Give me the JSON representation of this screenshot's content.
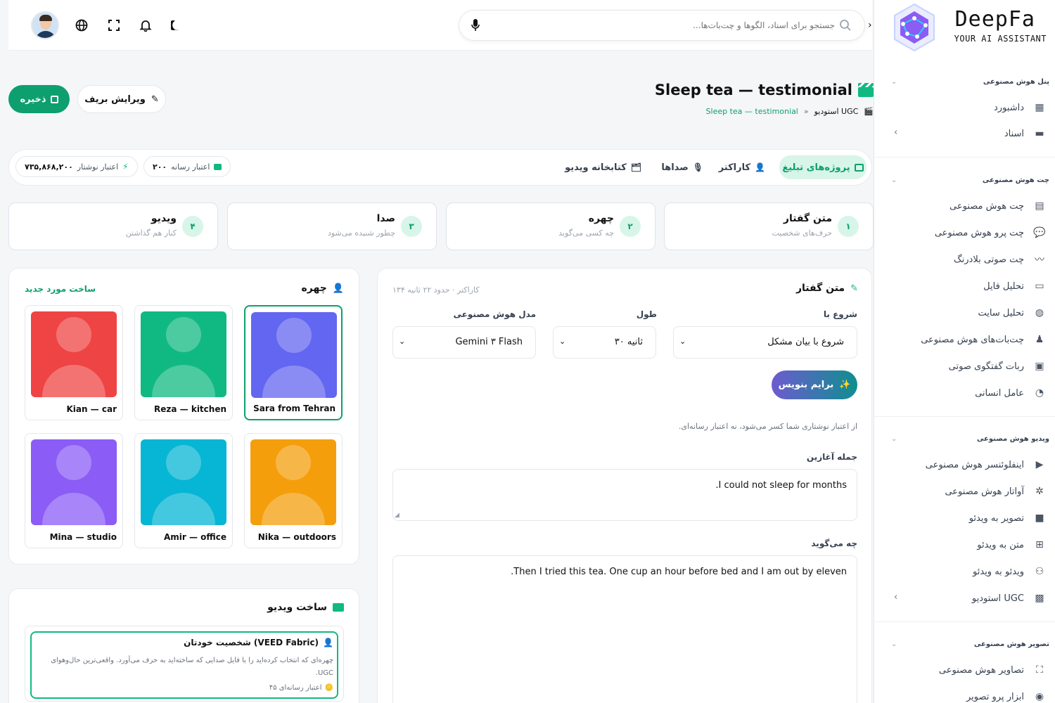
{
  "brand": {
    "name": "DeepFa",
    "tagline": "YOUR AI ASSISTANT"
  },
  "search": {
    "placeholder": "جستجو برای اسناد، الگوها و چت‌بات‌ها..."
  },
  "page": {
    "title": "Sleep tea — testimonial",
    "breadcrumb_root": "استودیو UGC",
    "breadcrumb_sep": "»",
    "breadcrumb_current": "Sleep tea — testimonial"
  },
  "actions": {
    "save": "ذخیره",
    "edit_brief": "ویرایش بریف"
  },
  "tabs": [
    {
      "label": "پروژه‌های تبلیغ"
    },
    {
      "label": "کاراکتر"
    },
    {
      "label": "صداها"
    },
    {
      "label": "کتابخانه ویدیو"
    }
  ],
  "credits": {
    "media_label": "اعتبار رسانه",
    "media_value": "۲۰۰",
    "writing_label": "اعتبار نوشتار",
    "writing_value": "۷۳۵,۸۶۸,۲۰۰"
  },
  "steps": [
    {
      "num": "۱",
      "title": "متن گفتار",
      "sub": "حرف‌های شخصیت"
    },
    {
      "num": "۲",
      "title": "چهره",
      "sub": "چه کسی می‌گوید"
    },
    {
      "num": "۳",
      "title": "صدا",
      "sub": "چطور شنیده می‌شود"
    },
    {
      "num": "۴",
      "title": "ویدیو",
      "sub": "کنار هم گذاشتن"
    }
  ],
  "script": {
    "title": "متن گفتار",
    "meta": "۱۳۴ کاراکتر · حدود ۲۲ ثانیه",
    "start_label": "شروع با",
    "start_value": "شروع با بیان مشکل",
    "length_label": "طول",
    "length_value": "۳۰ ثانیه",
    "model_label": "مدل هوش مصنوعی",
    "model_value": "Gemini ۳ Flash",
    "write_btn": "برایم بنویس",
    "note": "از اعتبار نوشتاری شما کسر می‌شود، نه اعتبار رسانه‌ای.",
    "hook_label": "جمله آغازین",
    "hook_value": "I could not sleep for months.",
    "says_label": "چه می‌گوید",
    "says_value": "Then I tried this tea. One cup an hour before bed and I am out by eleven."
  },
  "faces": {
    "title": "چهره",
    "new_link": "ساخت مورد جدید",
    "items": [
      {
        "name": "Sara from Tehran",
        "color": "#6366f1"
      },
      {
        "name": "Reza — kitchen",
        "color": "#10b981"
      },
      {
        "name": "Kian — car",
        "color": "#ef4444"
      },
      {
        "name": "Nika — outdoors",
        "color": "#f59e0b"
      },
      {
        "name": "Amir — office",
        "color": "#06b6d4"
      },
      {
        "name": "Mina — studio",
        "color": "#8b5cf6"
      }
    ]
  },
  "video": {
    "title": "ساخت ویدیو",
    "option_title": "شخصیت خودتان (VEED Fabric)",
    "option_desc": "چهره‌ای که انتخاب کرده‌اید را با فایل صدایی که ساخته‌اید به حرف می‌آورد. واقعی‌ترین حال‌وهوای UGC.",
    "option_cost": "۴۵ اعتبار رسانه‌ای"
  },
  "sidebar": {
    "sections": [
      {
        "title": "پنل هوش مصنوعی",
        "items": [
          {
            "label": "داشبورد",
            "icon": "dashboard-icon"
          },
          {
            "label": "اسناد",
            "icon": "folder-icon"
          }
        ]
      },
      {
        "title": "چت هوش مصنوعی",
        "items": [
          {
            "label": "چت هوش مصنوعی",
            "icon": "chat-icon"
          },
          {
            "label": "چت پرو هوش مصنوعی",
            "icon": "chat-pro-icon"
          },
          {
            "label": "چت صوتی بلادرنگ",
            "icon": "waveform-icon"
          },
          {
            "label": "تحلیل فایل",
            "icon": "file-icon"
          },
          {
            "label": "تحلیل سایت",
            "icon": "globe-icon"
          },
          {
            "label": "چت‌بات‌های هوش مصنوعی",
            "icon": "robot-icon"
          },
          {
            "label": "ربات گفتگوی صوتی",
            "icon": "voice-bot-icon"
          },
          {
            "label": "عامل انسانی",
            "icon": "headset-icon"
          }
        ]
      },
      {
        "title": "ویدیو هوش مصنوعی",
        "items": [
          {
            "label": "اینفلوئنسر هوش مصنوعی",
            "icon": "influencer-icon"
          },
          {
            "label": "آواتار هوش مصنوعی",
            "icon": "avatar-icon"
          },
          {
            "label": "تصویر به ویدئو",
            "icon": "video-icon"
          },
          {
            "label": "متن به ویدئو",
            "icon": "text-video-icon"
          },
          {
            "label": "ویدئو به ویدئو",
            "icon": "video-video-icon"
          },
          {
            "label": "استودیو UGC",
            "icon": "clapper-icon"
          }
        ]
      },
      {
        "title": "تصویر هوش مصنوعی",
        "items": [
          {
            "label": "تصاویر هوش مصنوعی",
            "icon": "image-icon"
          },
          {
            "label": "ابزار پرو تصویر",
            "icon": "image-pro-icon"
          }
        ]
      }
    ]
  }
}
